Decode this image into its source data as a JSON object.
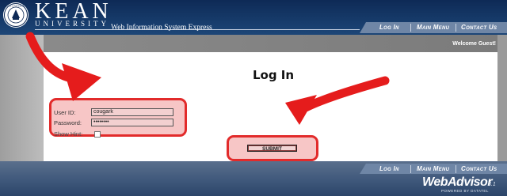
{
  "header": {
    "brand_name": "KEAN",
    "brand_sub": "UNIVERSITY",
    "app_subtitle": "Web Information System Express",
    "seal_text": "KEAN UNIVERSITY"
  },
  "nav": {
    "items": [
      {
        "label": "Log In"
      },
      {
        "label": "Main Menu"
      },
      {
        "label": "Contact Us"
      }
    ]
  },
  "welcome": {
    "text": "Welcome Guest!"
  },
  "page": {
    "title": "Log In"
  },
  "form": {
    "user_id_label": "User ID:",
    "user_id_value": "cougark",
    "password_label": "Password:",
    "password_value": "••••••••",
    "show_hint_label": "Show Hint:",
    "submit_label": "SUBMIT"
  },
  "footer": {
    "logo": "WebAdvisor",
    "version": "3.1",
    "powered_by": "POWERED BY DATATEL"
  },
  "colors": {
    "header_navy": "#0e2a56",
    "nav_tab": "#6f86a6",
    "highlight_fill": "#f7c6c6",
    "highlight_border": "#e22b2b",
    "annotation_arrow": "#e51c1c"
  },
  "icons": {
    "seal": "university-seal-icon",
    "arrows": "annotation-arrow-icon"
  }
}
